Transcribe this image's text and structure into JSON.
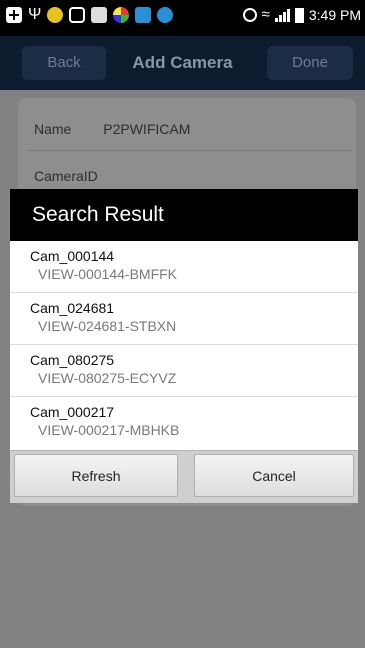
{
  "status_bar": {
    "time": "3:49 PM",
    "icons": [
      "add-icon",
      "usb-icon",
      "app-icon",
      "app-icon",
      "image-icon",
      "app-icon",
      "app-icon",
      "app-icon",
      "alarm-icon",
      "wifi-icon",
      "signal-icon",
      "battery-icon"
    ]
  },
  "nav": {
    "back_label": "Back",
    "title": "Add Camera",
    "done_label": "Done"
  },
  "form": {
    "name_label": "Name",
    "name_value": "P2PWIFICAM",
    "cameraid_label": "CameraID"
  },
  "dialog": {
    "title": "Search Result",
    "results": [
      {
        "name": "Cam_000144",
        "id": "VIEW-000144-BMFFK"
      },
      {
        "name": "Cam_024681",
        "id": "VIEW-024681-STBXN"
      },
      {
        "name": "Cam_080275",
        "id": "VIEW-080275-ECYVZ"
      },
      {
        "name": "Cam_000217",
        "id": "VIEW-000217-MBHKB"
      }
    ],
    "refresh_label": "Refresh",
    "cancel_label": "Cancel"
  },
  "colors": {
    "status_bar": "#000000",
    "nav_bar": "#0c1b2e",
    "dialog_header": "#000000",
    "dialog_body": "#ffffff"
  }
}
